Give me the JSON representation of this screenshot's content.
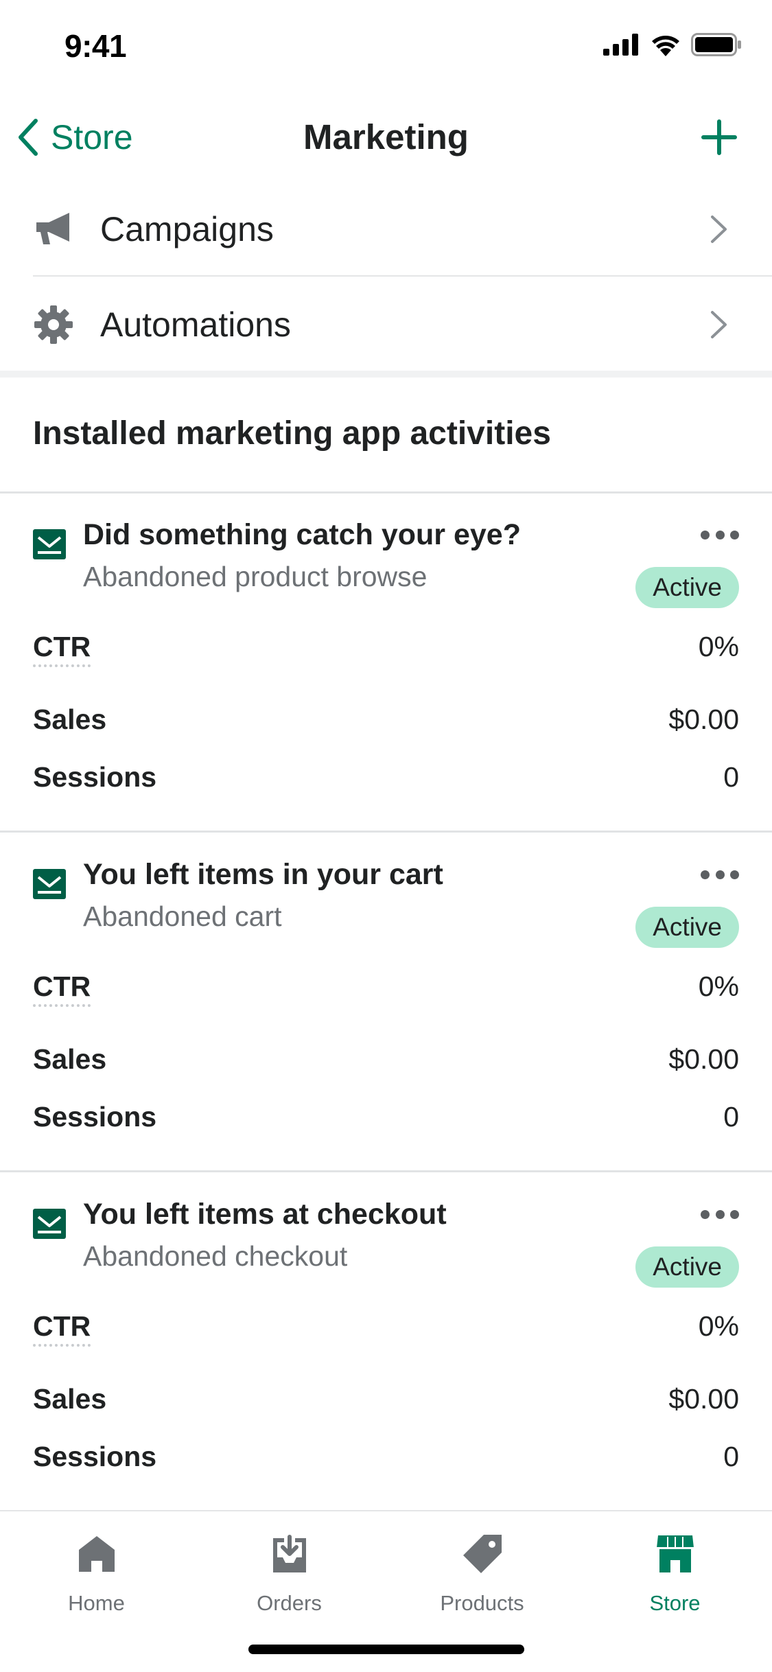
{
  "status_bar": {
    "time": "9:41"
  },
  "nav": {
    "back_label": "Store",
    "title": "Marketing"
  },
  "menu": [
    {
      "label": "Campaigns",
      "icon": "megaphone-icon"
    },
    {
      "label": "Automations",
      "icon": "gear-icon"
    }
  ],
  "section": {
    "title": "Installed marketing app activities"
  },
  "activities": [
    {
      "title": "Did something catch your eye?",
      "subtitle": "Abandoned product browse",
      "status": "Active",
      "metrics": [
        {
          "label": "CTR",
          "value": "0%"
        },
        {
          "label": "Sales",
          "value": "$0.00"
        },
        {
          "label": "Sessions",
          "value": "0"
        }
      ]
    },
    {
      "title": "You left items in your cart",
      "subtitle": "Abandoned cart",
      "status": "Active",
      "metrics": [
        {
          "label": "CTR",
          "value": "0%"
        },
        {
          "label": "Sales",
          "value": "$0.00"
        },
        {
          "label": "Sessions",
          "value": "0"
        }
      ]
    },
    {
      "title": "You left items at checkout",
      "subtitle": "Abandoned checkout",
      "status": "Active",
      "metrics": [
        {
          "label": "CTR",
          "value": "0%"
        },
        {
          "label": "Sales",
          "value": "$0.00"
        },
        {
          "label": "Sessions",
          "value": "0"
        }
      ]
    }
  ],
  "tabs": [
    {
      "label": "Home",
      "icon": "home-icon",
      "active": false
    },
    {
      "label": "Orders",
      "icon": "orders-icon",
      "active": false
    },
    {
      "label": "Products",
      "icon": "tag-icon",
      "active": false
    },
    {
      "label": "Store",
      "icon": "store-icon",
      "active": true
    }
  ],
  "colors": {
    "accent": "#008060",
    "badge_bg": "#aee9d1",
    "icon_gray": "#6d7175",
    "text": "#202223",
    "subdued_text": "#6d7175"
  }
}
